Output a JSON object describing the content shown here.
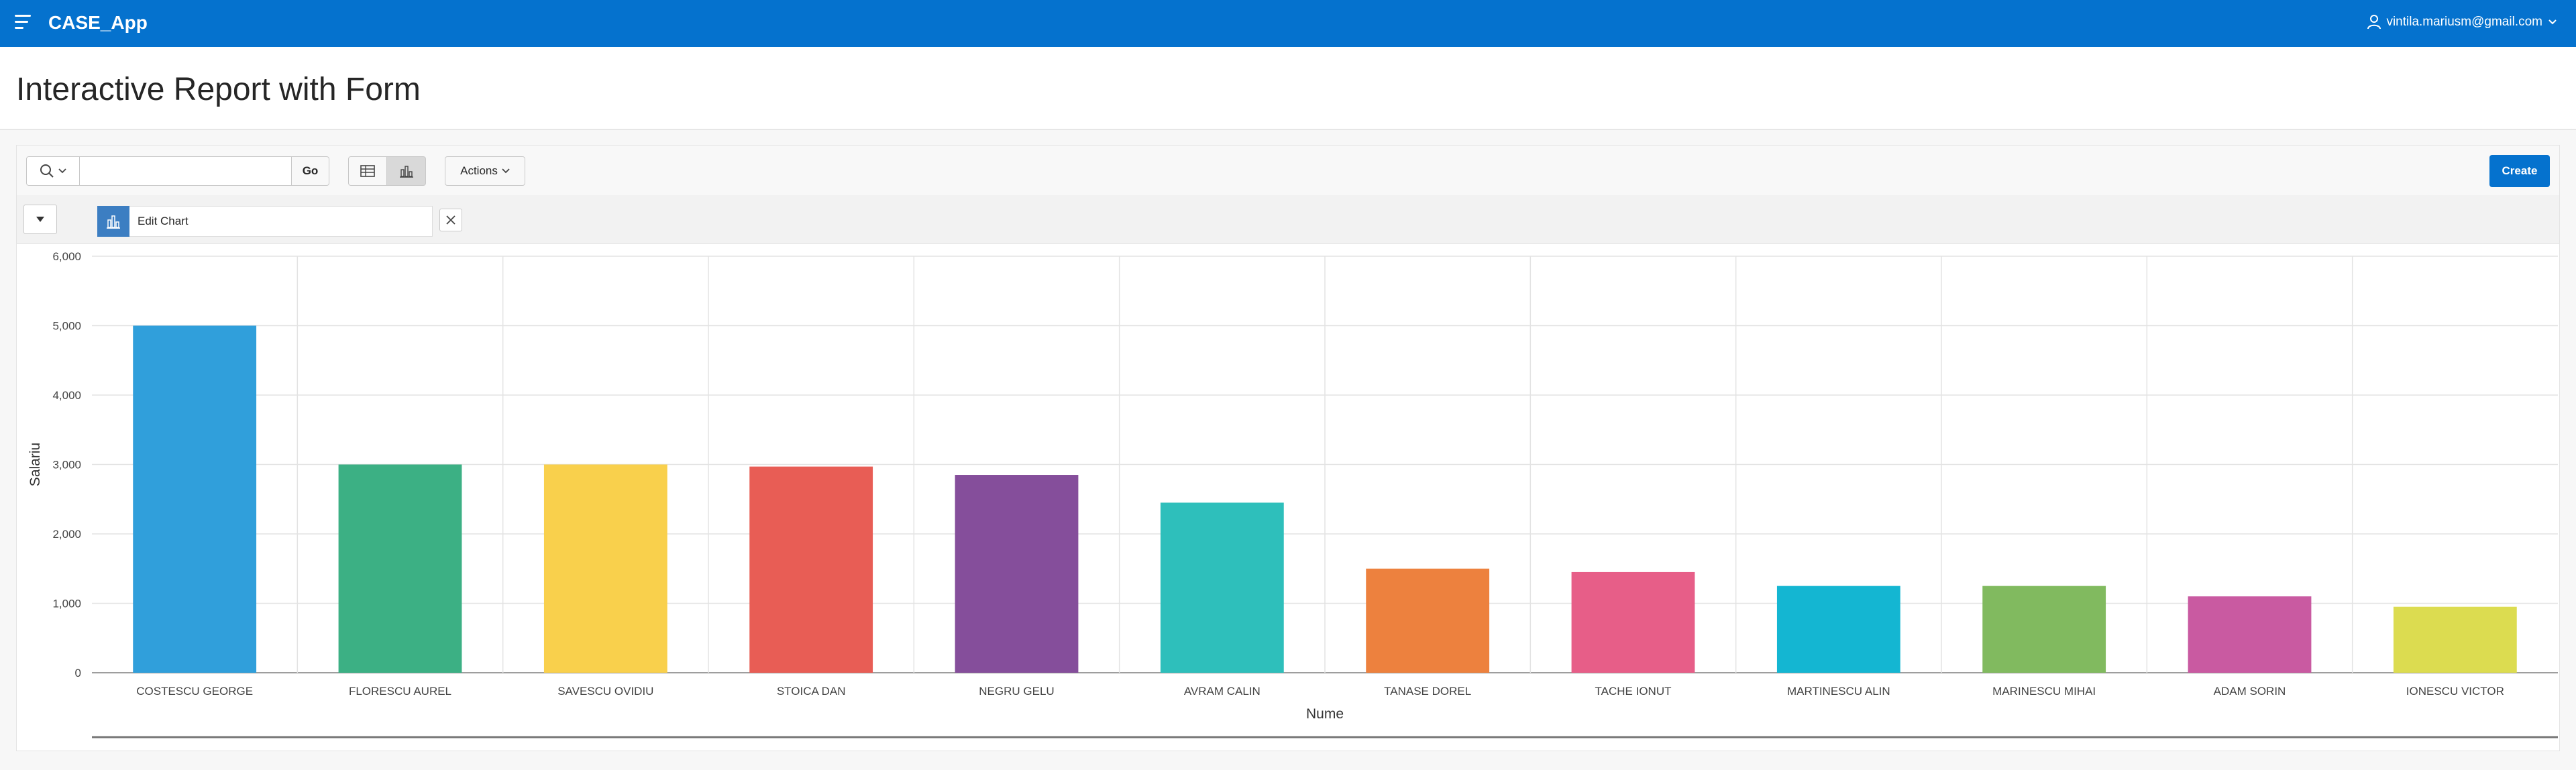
{
  "header": {
    "app_title": "CASE_App",
    "user_email": "vintila.mariusm@gmail.com",
    "brand_color": "#0572ce"
  },
  "page": {
    "title": "Interactive Report with Form"
  },
  "toolbar": {
    "search_value": "",
    "go_label": "Go",
    "actions_label": "Actions",
    "create_label": "Create",
    "active_view": "chart"
  },
  "filter": {
    "edit_chart_label": "Edit Chart"
  },
  "icons": {
    "menu": "hamburger-icon",
    "user": "user-icon",
    "search": "search-icon",
    "grid_view": "grid-view-icon",
    "chart_view": "bar-chart-icon",
    "close": "close-icon"
  },
  "chart_data": {
    "type": "bar",
    "xlabel": "Nume",
    "ylabel": "Salariu",
    "ylim": [
      0,
      6000
    ],
    "yticks": [
      "0",
      "1,000",
      "2,000",
      "3,000",
      "4,000",
      "5,000",
      "6,000"
    ],
    "grid": true,
    "categories": [
      "COSTESCU GEORGE",
      "FLORESCU AUREL",
      "SAVESCU OVIDIU",
      "STOICA DAN",
      "NEGRU GELU",
      "AVRAM CALIN",
      "TANASE DOREL",
      "TACHE IONUT",
      "MARTINESCU ALIN",
      "MARINESCU MIHAI",
      "ADAM SORIN",
      "IONESCU VICTOR"
    ],
    "values": [
      5000,
      3000,
      3000,
      2970,
      2850,
      2450,
      1500,
      1450,
      1250,
      1250,
      1100,
      950
    ],
    "colors": [
      "#309fdb",
      "#3cb084",
      "#f9d04c",
      "#e85d55",
      "#854e9b",
      "#2ebfbb",
      "#ed813e",
      "#e75e88",
      "#14b6d2",
      "#81ba5f",
      "#c95aa1",
      "#dcdc50"
    ]
  }
}
